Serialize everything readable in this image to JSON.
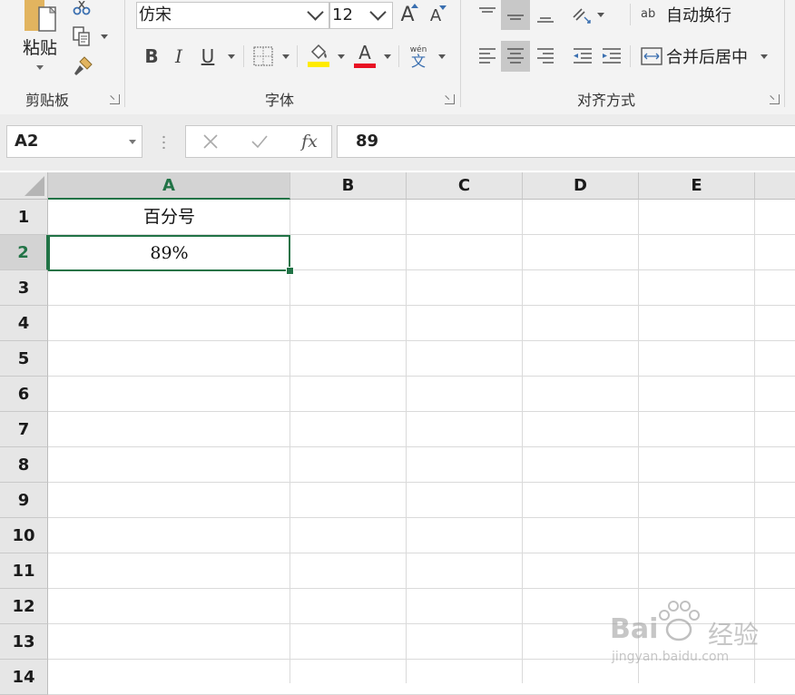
{
  "clipboard": {
    "paste_label": "粘贴",
    "group_label": "剪贴板"
  },
  "font": {
    "name": "仿宋",
    "size": "12",
    "grow_glyph": "A",
    "shrink_glyph": "A",
    "bold_glyph": "B",
    "italic_glyph": "I",
    "underline_glyph": "U",
    "font_color_glyph": "A",
    "phonetic_top": "wén",
    "phonetic_bottom": "文",
    "fill_color": "#ffeb00",
    "font_color": "#e81123",
    "group_label": "字体"
  },
  "alignment": {
    "wrap_label": "自动换行",
    "wrap_glyph": "ab",
    "merge_label": "合并后居中",
    "group_label": "对齐方式"
  },
  "formula_bar": {
    "name_box": "A2",
    "fx_label": "fx",
    "value": "89"
  },
  "grid": {
    "columns": [
      "A",
      "B",
      "C",
      "D",
      "E"
    ],
    "rows": [
      "1",
      "2",
      "3",
      "4",
      "5",
      "6",
      "7",
      "8",
      "9",
      "10",
      "11",
      "12",
      "13",
      "14"
    ],
    "cells": {
      "A1": "百分号",
      "A2": "89%"
    },
    "active_cell": "A2",
    "accent_color": "#217346"
  },
  "watermark": {
    "brand": "Bai",
    "brand_suffix": "经验",
    "url": "jingyan.baidu.com"
  }
}
